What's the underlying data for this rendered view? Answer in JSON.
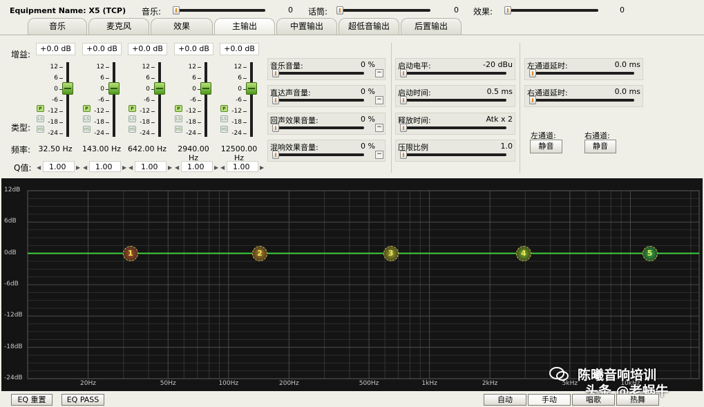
{
  "header": {
    "equipment_name": "Equipment Name: X5 (TCP)",
    "music_label": "音乐:",
    "music_value": "0",
    "mic_label": "话筒:",
    "mic_value": "0",
    "effect_label": "效果:",
    "effect_value": "0"
  },
  "tabs": [
    "音乐",
    "麦克风",
    "效果",
    "主输出",
    "中置输出",
    "超低音输出",
    "后置输出"
  ],
  "active_tab": "主输出",
  "eq": {
    "gain_label": "增益:",
    "type_label": "类型:",
    "freq_label": "频率:",
    "q_label": "Q值:",
    "scale": [
      "12",
      "6",
      "0",
      "-6",
      "-12",
      "-18",
      "-24"
    ],
    "type_buttons": [
      "P",
      "LS",
      "HS"
    ],
    "bands": [
      {
        "gain": "+0.0 dB",
        "freq": "32.50 Hz",
        "q": "1.00"
      },
      {
        "gain": "+0.0 dB",
        "freq": "143.00 Hz",
        "q": "1.00"
      },
      {
        "gain": "+0.0 dB",
        "freq": "642.00 Hz",
        "q": "1.00"
      },
      {
        "gain": "+0.0 dB",
        "freq": "2940.00 Hz",
        "q": "1.00"
      },
      {
        "gain": "+0.0 dB",
        "freq": "12500.00 Hz",
        "q": "1.00"
      }
    ]
  },
  "levels": [
    {
      "label": "音乐音量:",
      "value": "0 %"
    },
    {
      "label": "直达声音量:",
      "value": "0 %"
    },
    {
      "label": "回声效果音量:",
      "value": "0 %"
    },
    {
      "label": "混响效果音量:",
      "value": "0 %"
    }
  ],
  "limiter": [
    {
      "label": "启动电平:",
      "value": "-20 dBu"
    },
    {
      "label": "启动时间:",
      "value": "0.5 ms"
    },
    {
      "label": "释放时间:",
      "value": "Atk x 2"
    },
    {
      "label": "压限比例",
      "value": "1.0"
    }
  ],
  "delay": [
    {
      "label": "左通道延时:",
      "value": "0.0 ms"
    },
    {
      "label": "右通道延时:",
      "value": "0.0 ms"
    }
  ],
  "mute": {
    "left_label": "左通道:",
    "right_label": "右通道:",
    "button": "静音"
  },
  "graph": {
    "db_labels": [
      "12dB",
      "6dB",
      "0dB",
      "-6dB",
      "-12dB",
      "-18dB",
      "-24dB"
    ],
    "hz_labels": [
      "20Hz",
      "50Hz",
      "100Hz",
      "200Hz",
      "500Hz",
      "1kHz",
      "2kHz",
      "5kHz",
      "10kHz"
    ],
    "nodes": [
      "1",
      "2",
      "3",
      "4",
      "5"
    ],
    "line_color": "#3ecf3e"
  },
  "bottom": {
    "eq_reset": "EQ 重置",
    "eq_pass": "EQ PASS",
    "modes": [
      "自动",
      "手动",
      "唱歌",
      "热舞"
    ]
  },
  "watermark": "头条 @老蜗牛",
  "watermark_small": "陈曦音响培训"
}
